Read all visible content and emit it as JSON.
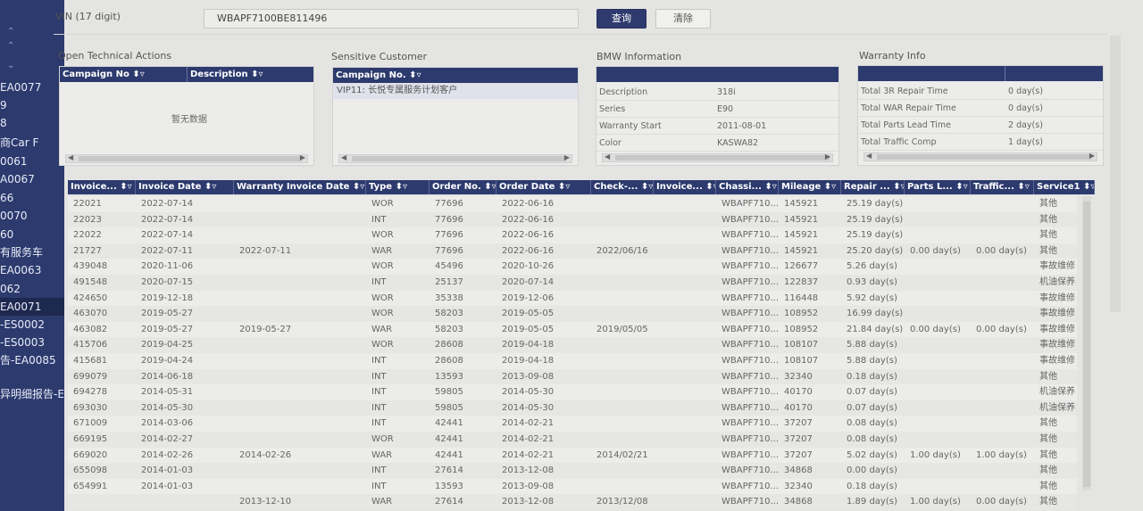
{
  "sidebar": {
    "items": [
      "EA0077",
      "9",
      "8",
      "商Car F",
      "0061",
      "A0067",
      "66",
      "0070",
      "60",
      "有服务车",
      "EA0063",
      "062",
      "EA0071",
      "-ES0002",
      "-ES0003",
      "告-EA0085",
      "异明细报告-E"
    ],
    "active_index": 12
  },
  "search": {
    "vin_label": "VIN (17 digit)",
    "vin_value": "WBAPF7100BE811496",
    "query_label": "查询",
    "clear_label": "清除"
  },
  "open_tech": {
    "title": "Open Technical Actions",
    "col_campaign": "Campaign No ⬍▿",
    "col_desc": "Description ⬍▿",
    "empty": "暂无数据"
  },
  "sensitive": {
    "title": "Sensitive Customer",
    "col_campaign": "Campaign No. ⬍▿",
    "row": "VIP11: 长悦专属服务计划客户"
  },
  "bmw_info": {
    "title": "BMW Information",
    "rows": [
      {
        "label": "Description",
        "value": "318i"
      },
      {
        "label": "Series",
        "value": "E90"
      },
      {
        "label": "Warranty Start",
        "value": "2011-08-01"
      },
      {
        "label": "Color",
        "value": "KASWA82"
      }
    ]
  },
  "warranty": {
    "title": "Warranty Info",
    "rows": [
      {
        "label": "Total 3R Repair Time",
        "value": "0 day(s)"
      },
      {
        "label": "Total WAR Repair Time",
        "value": "0 day(s)"
      },
      {
        "label": "Total Parts Lead Time",
        "value": "2 day(s)"
      },
      {
        "label": "Total Traffic Comp",
        "value": "1 day(s)"
      }
    ]
  },
  "grid": {
    "headers": [
      "Invoice... ⬍▿",
      "Invoice Date ⬍▿",
      "Warranty Invoice Date ⬍▿",
      "Type ⬍▿",
      "Order No. ⬍▿",
      "Order Date ⬍▿",
      "Check-... ⬍▿",
      "Invoice... ⬍▿",
      "Chassi... ⬍▿",
      "Mileage ⬍▿",
      "Repair ... ⬍▿",
      "Parts L... ⬍▿",
      "Traffic... ⬍▿",
      "Service1 ⬍▿"
    ],
    "rows": [
      [
        "22021",
        "2022-07-14",
        "",
        "WOR",
        "77696",
        "2022-06-16",
        "",
        "",
        "WBAPF710...",
        "145921",
        "25.19 day(s)",
        "",
        "",
        "其他"
      ],
      [
        "22023",
        "2022-07-14",
        "",
        "INT",
        "77696",
        "2022-06-16",
        "",
        "",
        "WBAPF710...",
        "145921",
        "25.19 day(s)",
        "",
        "",
        "其他"
      ],
      [
        "22022",
        "2022-07-14",
        "",
        "WOR",
        "77696",
        "2022-06-16",
        "",
        "",
        "WBAPF710...",
        "145921",
        "25.19 day(s)",
        "",
        "",
        "其他"
      ],
      [
        "21727",
        "2022-07-11",
        "2022-07-11",
        "WAR",
        "77696",
        "2022-06-16",
        "2022/06/16",
        "",
        "WBAPF710...",
        "145921",
        "25.20 day(s)",
        "0.00 day(s)",
        "0.00 day(s)",
        "其他"
      ],
      [
        "439048",
        "2020-11-06",
        "",
        "WOR",
        "45496",
        "2020-10-26",
        "",
        "",
        "WBAPF710...",
        "126677",
        "5.26 day(s)",
        "",
        "",
        "事故维修"
      ],
      [
        "491548",
        "2020-07-15",
        "",
        "INT",
        "25137",
        "2020-07-14",
        "",
        "",
        "WBAPF710...",
        "122837",
        "0.93 day(s)",
        "",
        "",
        "机油保养"
      ],
      [
        "424650",
        "2019-12-18",
        "",
        "WOR",
        "35338",
        "2019-12-06",
        "",
        "",
        "WBAPF710...",
        "116448",
        "5.92 day(s)",
        "",
        "",
        "事故维修"
      ],
      [
        "463070",
        "2019-05-27",
        "",
        "WOR",
        "58203",
        "2019-05-05",
        "",
        "",
        "WBAPF710...",
        "108952",
        "16.99 day(s)",
        "",
        "",
        "事故维修"
      ],
      [
        "463082",
        "2019-05-27",
        "2019-05-27",
        "WAR",
        "58203",
        "2019-05-05",
        "2019/05/05",
        "",
        "WBAPF710...",
        "108952",
        "21.84 day(s)",
        "0.00 day(s)",
        "0.00 day(s)",
        "事故维修"
      ],
      [
        "415706",
        "2019-04-25",
        "",
        "WOR",
        "28608",
        "2019-04-18",
        "",
        "",
        "WBAPF710...",
        "108107",
        "5.88 day(s)",
        "",
        "",
        "事故维修"
      ],
      [
        "415681",
        "2019-04-24",
        "",
        "INT",
        "28608",
        "2019-04-18",
        "",
        "",
        "WBAPF710...",
        "108107",
        "5.88 day(s)",
        "",
        "",
        "事故维修"
      ],
      [
        "699079",
        "2014-06-18",
        "",
        "INT",
        "13593",
        "2013-09-08",
        "",
        "",
        "WBAPF710...",
        "32340",
        "0.18 day(s)",
        "",
        "",
        "其他"
      ],
      [
        "694278",
        "2014-05-31",
        "",
        "INT",
        "59805",
        "2014-05-30",
        "",
        "",
        "WBAPF710...",
        "40170",
        "0.07 day(s)",
        "",
        "",
        "机油保养"
      ],
      [
        "693030",
        "2014-05-30",
        "",
        "INT",
        "59805",
        "2014-05-30",
        "",
        "",
        "WBAPF710...",
        "40170",
        "0.07 day(s)",
        "",
        "",
        "机油保养"
      ],
      [
        "671009",
        "2014-03-06",
        "",
        "INT",
        "42441",
        "2014-02-21",
        "",
        "",
        "WBAPF710...",
        "37207",
        "0.08 day(s)",
        "",
        "",
        "其他"
      ],
      [
        "669195",
        "2014-02-27",
        "",
        "WOR",
        "42441",
        "2014-02-21",
        "",
        "",
        "WBAPF710...",
        "37207",
        "0.08 day(s)",
        "",
        "",
        "其他"
      ],
      [
        "669020",
        "2014-02-26",
        "2014-02-26",
        "WAR",
        "42441",
        "2014-02-21",
        "2014/02/21",
        "",
        "WBAPF710...",
        "37207",
        "5.02 day(s)",
        "1.00 day(s)",
        "1.00 day(s)",
        "其他"
      ],
      [
        "655098",
        "2014-01-03",
        "",
        "INT",
        "27614",
        "2013-12-08",
        "",
        "",
        "WBAPF710...",
        "34868",
        "0.00 day(s)",
        "",
        "",
        "其他"
      ],
      [
        "654991",
        "2014-01-03",
        "",
        "INT",
        "13593",
        "2013-09-08",
        "",
        "",
        "WBAPF710...",
        "32340",
        "0.18 day(s)",
        "",
        "",
        "其他"
      ],
      [
        "",
        "",
        "2013-12-10",
        "WAR",
        "27614",
        "2013-12-08",
        "2013/12/08",
        "",
        "WBAPF710...",
        "34868",
        "1.89 day(s)",
        "1.00 day(s)",
        "0.00 day(s)",
        "其他"
      ]
    ]
  }
}
